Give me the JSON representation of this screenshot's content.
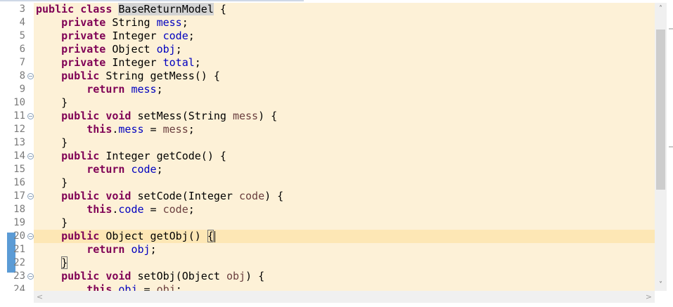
{
  "editor": {
    "lines": [
      {
        "n": "3",
        "fold": false,
        "current": false,
        "changed": false,
        "tokens": [
          [
            "kw",
            "public"
          ],
          [
            "",
            "·"
          ],
          [
            "kw",
            "class"
          ],
          [
            "",
            "·"
          ],
          [
            "cls-hl",
            "BaseReturnModel"
          ],
          [
            "",
            "·{"
          ]
        ]
      },
      {
        "n": "4",
        "fold": false,
        "current": false,
        "changed": false,
        "tokens": [
          [
            "",
            "    "
          ],
          [
            "kw",
            "private"
          ],
          [
            "",
            "·String·"
          ],
          [
            "fld",
            "mess"
          ],
          [
            "",
            ";"
          ]
        ]
      },
      {
        "n": "5",
        "fold": false,
        "current": false,
        "changed": false,
        "tokens": [
          [
            "",
            "    "
          ],
          [
            "kw",
            "private"
          ],
          [
            "",
            "·Integer·"
          ],
          [
            "fld",
            "code"
          ],
          [
            "",
            ";"
          ]
        ]
      },
      {
        "n": "6",
        "fold": false,
        "current": false,
        "changed": false,
        "tokens": [
          [
            "",
            "    "
          ],
          [
            "kw",
            "private"
          ],
          [
            "",
            "·Object·"
          ],
          [
            "fld",
            "obj"
          ],
          [
            "",
            ";"
          ]
        ]
      },
      {
        "n": "7",
        "fold": false,
        "current": false,
        "changed": false,
        "tokens": [
          [
            "",
            "    "
          ],
          [
            "kw",
            "private"
          ],
          [
            "",
            "·Integer·"
          ],
          [
            "fld",
            "total"
          ],
          [
            "",
            ";"
          ]
        ]
      },
      {
        "n": "8",
        "fold": true,
        "current": false,
        "changed": false,
        "tokens": [
          [
            "",
            "    "
          ],
          [
            "kw",
            "public"
          ],
          [
            "",
            "·String·getMess()·{"
          ]
        ]
      },
      {
        "n": "9",
        "fold": false,
        "current": false,
        "changed": false,
        "tokens": [
          [
            "",
            "        "
          ],
          [
            "kw",
            "return"
          ],
          [
            "",
            "·"
          ],
          [
            "fld",
            "mess"
          ],
          [
            "",
            ";"
          ]
        ]
      },
      {
        "n": "10",
        "fold": false,
        "current": false,
        "changed": false,
        "tokens": [
          [
            "",
            "    }"
          ]
        ]
      },
      {
        "n": "11",
        "fold": true,
        "current": false,
        "changed": false,
        "tokens": [
          [
            "",
            "    "
          ],
          [
            "kw",
            "public"
          ],
          [
            "",
            "·"
          ],
          [
            "kw",
            "void"
          ],
          [
            "",
            "·setMess(String·"
          ],
          [
            "prm",
            "mess"
          ],
          [
            "",
            ")·{"
          ]
        ]
      },
      {
        "n": "12",
        "fold": false,
        "current": false,
        "changed": false,
        "tokens": [
          [
            "",
            "        "
          ],
          [
            "kw",
            "this"
          ],
          [
            "",
            "."
          ],
          [
            "fld",
            "mess"
          ],
          [
            "",
            "·=·"
          ],
          [
            "prm",
            "mess"
          ],
          [
            "",
            ";"
          ]
        ]
      },
      {
        "n": "13",
        "fold": false,
        "current": false,
        "changed": false,
        "tokens": [
          [
            "",
            "    }"
          ]
        ]
      },
      {
        "n": "14",
        "fold": true,
        "current": false,
        "changed": false,
        "tokens": [
          [
            "",
            "    "
          ],
          [
            "kw",
            "public"
          ],
          [
            "",
            "·Integer·getCode()·{"
          ]
        ]
      },
      {
        "n": "15",
        "fold": false,
        "current": false,
        "changed": false,
        "tokens": [
          [
            "",
            "        "
          ],
          [
            "kw",
            "return"
          ],
          [
            "",
            "·"
          ],
          [
            "fld",
            "code"
          ],
          [
            "",
            ";"
          ]
        ]
      },
      {
        "n": "16",
        "fold": false,
        "current": false,
        "changed": false,
        "tokens": [
          [
            "",
            "    }"
          ]
        ]
      },
      {
        "n": "17",
        "fold": true,
        "current": false,
        "changed": false,
        "tokens": [
          [
            "",
            "    "
          ],
          [
            "kw",
            "public"
          ],
          [
            "",
            "·"
          ],
          [
            "kw",
            "void"
          ],
          [
            "",
            "·setCode(Integer·"
          ],
          [
            "prm",
            "code"
          ],
          [
            "",
            ")·{"
          ]
        ]
      },
      {
        "n": "18",
        "fold": false,
        "current": false,
        "changed": false,
        "tokens": [
          [
            "",
            "        "
          ],
          [
            "kw",
            "this"
          ],
          [
            "",
            "."
          ],
          [
            "fld",
            "code"
          ],
          [
            "",
            "·=·"
          ],
          [
            "prm",
            "code"
          ],
          [
            "",
            ";"
          ]
        ]
      },
      {
        "n": "19",
        "fold": false,
        "current": false,
        "changed": false,
        "tokens": [
          [
            "",
            "    }"
          ]
        ]
      },
      {
        "n": "20",
        "fold": true,
        "current": true,
        "changed": true,
        "tokens": [
          [
            "",
            "    "
          ],
          [
            "kw",
            "public"
          ],
          [
            "",
            "·Object·getObj()·"
          ],
          [
            "brk",
            "{"
          ],
          [
            "caret",
            ""
          ]
        ]
      },
      {
        "n": "21",
        "fold": false,
        "current": false,
        "changed": true,
        "tokens": [
          [
            "",
            "        "
          ],
          [
            "kw",
            "return"
          ],
          [
            "",
            "·"
          ],
          [
            "fld",
            "obj"
          ],
          [
            "",
            ";"
          ]
        ]
      },
      {
        "n": "22",
        "fold": false,
        "current": false,
        "changed": true,
        "tokens": [
          [
            "",
            "    "
          ],
          [
            "brk",
            "}"
          ]
        ]
      },
      {
        "n": "23",
        "fold": true,
        "current": false,
        "changed": false,
        "tokens": [
          [
            "",
            "    "
          ],
          [
            "kw",
            "public"
          ],
          [
            "",
            "·"
          ],
          [
            "kw",
            "void"
          ],
          [
            "",
            "·setObj(Object·"
          ],
          [
            "prm",
            "obj"
          ],
          [
            "",
            ")·{"
          ]
        ]
      },
      {
        "n": "24",
        "fold": false,
        "current": false,
        "changed": false,
        "tokens": [
          [
            "",
            "        "
          ],
          [
            "kw",
            "this"
          ],
          [
            "",
            "."
          ],
          [
            "fld",
            "obj"
          ],
          [
            "",
            "·=·"
          ],
          [
            "prm",
            "obj"
          ],
          [
            "",
            ";"
          ]
        ]
      }
    ]
  },
  "scrollbars": {
    "up_icon": "chevron-up-icon",
    "up_glyph": "˄",
    "down_icon": "chevron-down-icon",
    "down_glyph": "˅",
    "left_icon": "chevron-left-icon",
    "left_glyph": "<",
    "right_icon": "chevron-right-icon",
    "right_glyph": ">"
  },
  "colors": {
    "background": "#fdf1d7",
    "current_line": "#fde7b5",
    "keyword": "#7f0055",
    "field": "#0000c0",
    "parameter": "#6a3e3e",
    "change_marker": "#5b9bd5"
  }
}
